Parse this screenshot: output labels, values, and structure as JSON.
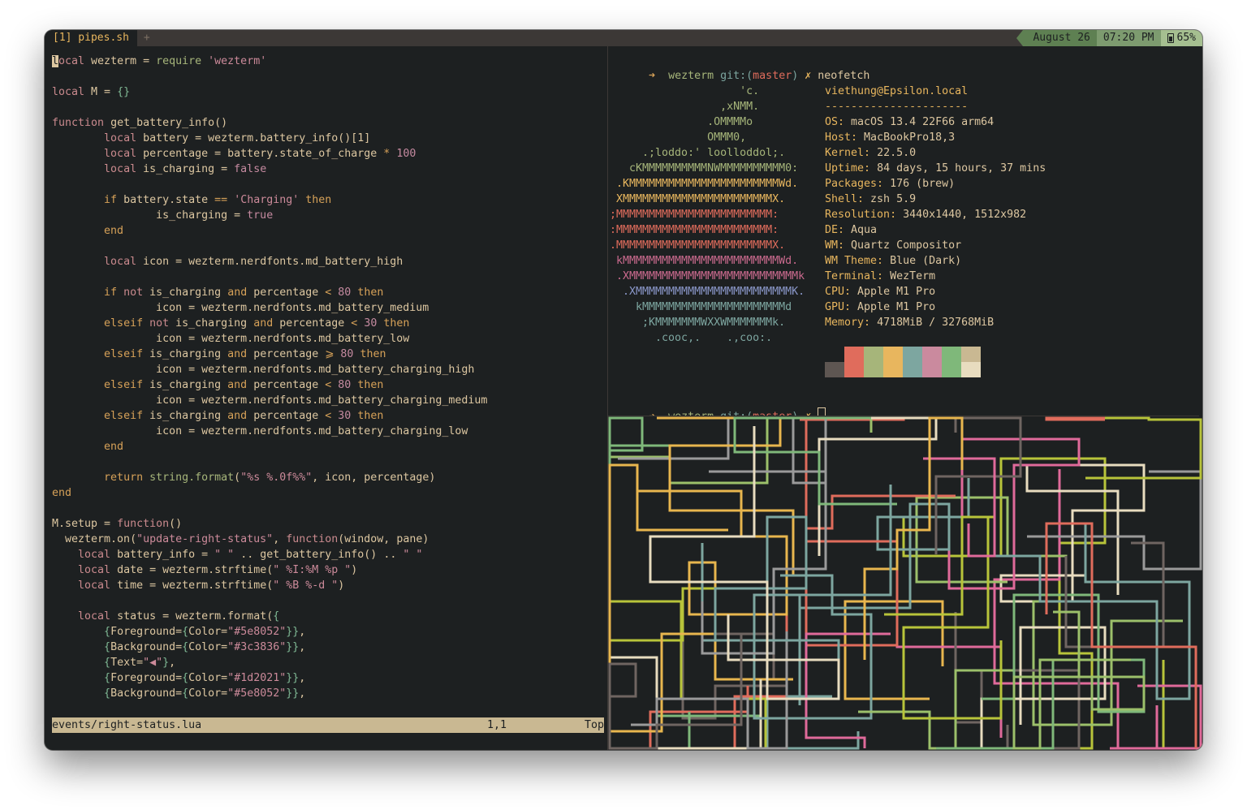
{
  "tab": {
    "label": "[1] pipes.sh",
    "new_tab": "+"
  },
  "status": {
    "date": "August 26",
    "time": "07:20 PM",
    "battery": "65%"
  },
  "editor": {
    "lines": [
      [
        [
          "cursor",
          "l"
        ],
        [
          "kw",
          "ocal "
        ],
        [
          "id",
          "wezterm = "
        ],
        [
          "fn",
          "require "
        ],
        [
          "str",
          "'wezterm'"
        ]
      ],
      [],
      [
        [
          "kw",
          "local "
        ],
        [
          "id",
          "M = "
        ],
        [
          "brk",
          "{}"
        ]
      ],
      [],
      [
        [
          "kw",
          "function "
        ],
        [
          "id",
          "get_battery_info()"
        ]
      ],
      [
        [
          "id",
          "        "
        ],
        [
          "kw",
          "local "
        ],
        [
          "id",
          "battery = wezterm.battery_info()[1]"
        ]
      ],
      [
        [
          "id",
          "        "
        ],
        [
          "kw",
          "local "
        ],
        [
          "id",
          "percentage = battery.state_of_charge "
        ],
        [
          "op",
          "* "
        ],
        [
          "num",
          "100"
        ]
      ],
      [
        [
          "id",
          "        "
        ],
        [
          "kw",
          "local "
        ],
        [
          "id",
          "is_charging = "
        ],
        [
          "num",
          "false"
        ]
      ],
      [],
      [
        [
          "id",
          "        "
        ],
        [
          "op",
          "if "
        ],
        [
          "id",
          "battery.state "
        ],
        [
          "op",
          "== "
        ],
        [
          "str",
          "'Charging' "
        ],
        [
          "op",
          "then"
        ]
      ],
      [
        [
          "id",
          "                is_charging = "
        ],
        [
          "num",
          "true"
        ]
      ],
      [
        [
          "id",
          "        "
        ],
        [
          "op",
          "end"
        ]
      ],
      [],
      [
        [
          "id",
          "        "
        ],
        [
          "kw",
          "local "
        ],
        [
          "id",
          "icon = wezterm.nerdfonts.md_battery_high"
        ]
      ],
      [],
      [
        [
          "id",
          "        "
        ],
        [
          "op",
          "if "
        ],
        [
          "kw",
          "not "
        ],
        [
          "id",
          "is_charging "
        ],
        [
          "op",
          "and "
        ],
        [
          "id",
          "percentage "
        ],
        [
          "op",
          "< "
        ],
        [
          "num",
          "80 "
        ],
        [
          "op",
          "then"
        ]
      ],
      [
        [
          "id",
          "                icon = wezterm.nerdfonts.md_battery_medium"
        ]
      ],
      [
        [
          "id",
          "        "
        ],
        [
          "op",
          "elseif "
        ],
        [
          "kw",
          "not "
        ],
        [
          "id",
          "is_charging "
        ],
        [
          "op",
          "and "
        ],
        [
          "id",
          "percentage "
        ],
        [
          "op",
          "< "
        ],
        [
          "num",
          "30 "
        ],
        [
          "op",
          "then"
        ]
      ],
      [
        [
          "id",
          "                icon = wezterm.nerdfonts.md_battery_low"
        ]
      ],
      [
        [
          "id",
          "        "
        ],
        [
          "op",
          "elseif "
        ],
        [
          "id",
          "is_charging "
        ],
        [
          "op",
          "and "
        ],
        [
          "id",
          "percentage "
        ],
        [
          "op",
          "⩾ "
        ],
        [
          "num",
          "80 "
        ],
        [
          "op",
          "then"
        ]
      ],
      [
        [
          "id",
          "                icon = wezterm.nerdfonts.md_battery_charging_high"
        ]
      ],
      [
        [
          "id",
          "        "
        ],
        [
          "op",
          "elseif "
        ],
        [
          "id",
          "is_charging "
        ],
        [
          "op",
          "and "
        ],
        [
          "id",
          "percentage "
        ],
        [
          "op",
          "< "
        ],
        [
          "num",
          "80 "
        ],
        [
          "op",
          "then"
        ]
      ],
      [
        [
          "id",
          "                icon = wezterm.nerdfonts.md_battery_charging_medium"
        ]
      ],
      [
        [
          "id",
          "        "
        ],
        [
          "op",
          "elseif "
        ],
        [
          "id",
          "is_charging "
        ],
        [
          "op",
          "and "
        ],
        [
          "id",
          "percentage "
        ],
        [
          "op",
          "< "
        ],
        [
          "num",
          "30 "
        ],
        [
          "op",
          "then"
        ]
      ],
      [
        [
          "id",
          "                icon = wezterm.nerdfonts.md_battery_charging_low"
        ]
      ],
      [
        [
          "id",
          "        "
        ],
        [
          "op",
          "end"
        ]
      ],
      [],
      [
        [
          "id",
          "        "
        ],
        [
          "op",
          "return "
        ],
        [
          "fn",
          "string.format"
        ],
        [
          "id",
          "("
        ],
        [
          "str",
          "\"%s %.0f%%\""
        ],
        [
          "id",
          ", icon, percentage)"
        ]
      ],
      [
        [
          "op",
          "end"
        ]
      ],
      [],
      [
        [
          "id",
          "M.setup = "
        ],
        [
          "kw",
          "function"
        ],
        [
          "id",
          "()"
        ]
      ],
      [
        [
          "id",
          "  wezterm.on("
        ],
        [
          "str",
          "\"update-right-status\""
        ],
        [
          "id",
          ", "
        ],
        [
          "kw",
          "function"
        ],
        [
          "id",
          "(window, pane)"
        ]
      ],
      [
        [
          "id",
          "    "
        ],
        [
          "kw",
          "local "
        ],
        [
          "id",
          "battery_info = "
        ],
        [
          "str",
          "\" \" "
        ],
        [
          "id",
          ".. get_battery_info() .. "
        ],
        [
          "str",
          "\" \""
        ]
      ],
      [
        [
          "id",
          "    "
        ],
        [
          "kw",
          "local "
        ],
        [
          "id",
          "date = wezterm.strftime("
        ],
        [
          "str",
          "\" %I:%M %p \""
        ],
        [
          "id",
          ")"
        ]
      ],
      [
        [
          "id",
          "    "
        ],
        [
          "kw",
          "local "
        ],
        [
          "id",
          "time = wezterm.strftime("
        ],
        [
          "str",
          "\" %B %-d \""
        ],
        [
          "id",
          ")"
        ]
      ],
      [],
      [
        [
          "id",
          "    "
        ],
        [
          "kw",
          "local "
        ],
        [
          "id",
          "status = wezterm.format("
        ],
        [
          "brk",
          "{"
        ]
      ],
      [
        [
          "id",
          "        "
        ],
        [
          "brk",
          "{"
        ],
        [
          "id",
          "Foreground="
        ],
        [
          "brk",
          "{"
        ],
        [
          "id",
          "Color="
        ],
        [
          "str",
          "\"#5e8052\""
        ],
        [
          "brk",
          "}}"
        ],
        [
          "id",
          ","
        ]
      ],
      [
        [
          "id",
          "        "
        ],
        [
          "brk",
          "{"
        ],
        [
          "id",
          "Background="
        ],
        [
          "brk",
          "{"
        ],
        [
          "id",
          "Color="
        ],
        [
          "str",
          "\"#3c3836\""
        ],
        [
          "brk",
          "}}"
        ],
        [
          "id",
          ","
        ]
      ],
      [
        [
          "id",
          "        "
        ],
        [
          "brk",
          "{"
        ],
        [
          "id",
          "Text="
        ],
        [
          "str",
          "\"◀\""
        ],
        [
          "brk",
          "}"
        ],
        [
          "id",
          ","
        ]
      ],
      [
        [
          "id",
          "        "
        ],
        [
          "brk",
          "{"
        ],
        [
          "id",
          "Foreground="
        ],
        [
          "brk",
          "{"
        ],
        [
          "id",
          "Color="
        ],
        [
          "str",
          "\"#1d2021\""
        ],
        [
          "brk",
          "}}"
        ],
        [
          "id",
          ","
        ]
      ],
      [
        [
          "id",
          "        "
        ],
        [
          "brk",
          "{"
        ],
        [
          "id",
          "Background="
        ],
        [
          "brk",
          "{"
        ],
        [
          "id",
          "Color="
        ],
        [
          "str",
          "\"#5e8052\""
        ],
        [
          "brk",
          "}}"
        ],
        [
          "id",
          ","
        ]
      ]
    ],
    "statusline": {
      "file": "events/right-status.lua",
      "position": "1,1",
      "scroll": "Top"
    }
  },
  "terminal": {
    "prompt_arrow": "➜",
    "prompt_dir": "wezterm",
    "prompt_git": "git:(",
    "prompt_branch": "master",
    "prompt_git_close": ")",
    "prompt_x": "✗",
    "command": "neofetch",
    "logo": [
      [
        "#a6b57a",
        "                    'c."
      ],
      [
        "#a6b57a",
        "                 ,xNMM."
      ],
      [
        "#a6b57a",
        "               .OMMMMo"
      ],
      [
        "#a6b57a",
        "               OMMM0,"
      ],
      [
        "#a6b57a",
        "     .;loddo:' loolloddol;."
      ],
      [
        "#a6b57a",
        "   cKMMMMMMMMMMNWMMMMMMMMMM0:"
      ],
      [
        "#e8b65e",
        " .KMMMMMMMMMMMMMMMMMMMMMMMWd."
      ],
      [
        "#e8b65e",
        " XMMMMMMMMMMMMMMMMMMMMMMMX."
      ],
      [
        "#e06c5c",
        ";MMMMMMMMMMMMMMMMMMMMMMMM:"
      ],
      [
        "#e06c5c",
        ":MMMMMMMMMMMMMMMMMMMMMMMM:"
      ],
      [
        "#e06c5c",
        ".MMMMMMMMMMMMMMMMMMMMMMMMX."
      ],
      [
        "#ca6a8e",
        " kMMMMMMMMMMMMMMMMMMMMMMMMWd."
      ],
      [
        "#ca6a8e",
        " .XMMMMMMMMMMMMMMMMMMMMMMMMMMk"
      ],
      [
        "#8a97c9",
        "  .XMMMMMMMMMMMMMMMMMMMMMMMMK."
      ],
      [
        "#7da6a0",
        "    kMMMMMMMMMMMMMMMMMMMMMMd"
      ],
      [
        "#7da6a0",
        "     ;KMMMMMMMWXXWMMMMMMMk."
      ],
      [
        "#7da6a0",
        "       .cooc,.    .,coo:."
      ]
    ],
    "user": "viethung@Epsilon.local",
    "dashes": "----------------------",
    "info": [
      {
        "k": "OS",
        "v": "macOS 13.4 22F66 arm64"
      },
      {
        "k": "Host",
        "v": "MacBookPro18,3"
      },
      {
        "k": "Kernel",
        "v": "22.5.0"
      },
      {
        "k": "Uptime",
        "v": "84 days, 15 hours, 37 mins"
      },
      {
        "k": "Packages",
        "v": "176 (brew)"
      },
      {
        "k": "Shell",
        "v": "zsh 5.9"
      },
      {
        "k": "Resolution",
        "v": "3440x1440, 1512x982"
      },
      {
        "k": "DE",
        "v": "Aqua"
      },
      {
        "k": "WM",
        "v": "Quartz Compositor"
      },
      {
        "k": "WM Theme",
        "v": "Blue (Dark)"
      },
      {
        "k": "Terminal",
        "v": "WezTerm"
      },
      {
        "k": "CPU",
        "v": "Apple M1 Pro"
      },
      {
        "k": "GPU",
        "v": "Apple M1 Pro"
      },
      {
        "k": "Memory",
        "v": "4718MiB / 32768MiB"
      }
    ],
    "palette_top": [
      "#1d2021",
      "#e06c5c",
      "#a6b57a",
      "#e8b65e",
      "#7da6a0",
      "#ca8a9e",
      "#7fb87a",
      "#c9b892"
    ],
    "palette_bottom": [
      "#5e5652",
      "#e06c5c",
      "#a6b57a",
      "#e8b65e",
      "#7da6a0",
      "#ca8a9e",
      "#7fb87a",
      "#e8dcbf"
    ]
  },
  "pipes": {
    "colors": [
      "#b8c43a",
      "#e06a9a",
      "#e8b64e",
      "#7da6a0",
      "#e8dcbf",
      "#6f6561",
      "#e06c5c",
      "#9cc06a",
      "#7fb87a",
      "#9a9a9a"
    ]
  }
}
